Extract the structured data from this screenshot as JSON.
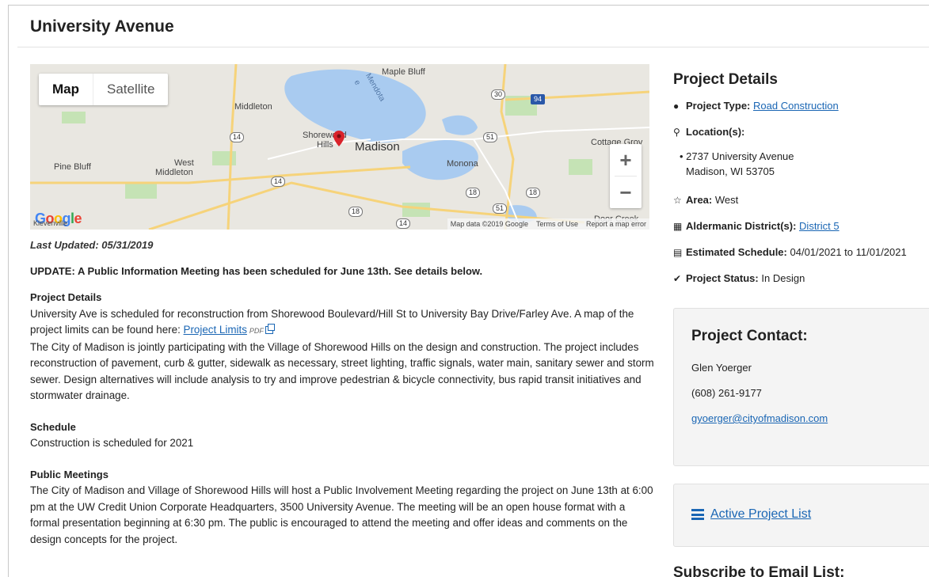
{
  "page": {
    "title": "University Avenue"
  },
  "map": {
    "type_map": "Map",
    "type_satellite": "Satellite",
    "zoom_in": "+",
    "zoom_out": "−",
    "labels": {
      "maple_bluff": "Maple Bluff",
      "middleton": "Middleton",
      "shorewood": "Shorewood",
      "hills": "Hills",
      "madison": "Madison",
      "cottage_grove": "Cottage Grov",
      "pine_bluff": "Pine Bluff",
      "west": "West",
      "west_middleton": "Middleton",
      "monona": "Monona",
      "door_creek": "Door Creek",
      "kleven": "Klevenville",
      "mendota": "Mendota",
      "lake": "e"
    },
    "shields": {
      "r30": "30",
      "r94": "94",
      "r14a": "14",
      "r51a": "51",
      "r14b": "14",
      "r18a": "18",
      "r18b": "18",
      "r18c": "18",
      "r51b": "51",
      "r14c": "14"
    },
    "google": [
      "G",
      "o",
      "o",
      "g",
      "l",
      "e"
    ],
    "attr_data": "Map data ©2019 Google",
    "attr_terms": "Terms of Use",
    "attr_report": "Report a map error"
  },
  "main": {
    "last_updated": "Last Updated: 05/31/2019",
    "update_banner": "UPDATE: A Public Information Meeting has been scheduled for June 13th. See details below.",
    "details_heading": "Project Details",
    "details_p1": "University Ave is scheduled for reconstruction from Shorewood Boulevard/Hill St to University Bay Drive/Farley Ave. A map of the project limits can be found here: ",
    "project_limits_link": "Project Limits",
    "pdf_tag": "PDF",
    "details_p2": "The City of Madison is jointly participating with the Village of Shorewood Hills on the design and construction.  The project includes reconstruction of pavement, curb & gutter, sidewalk as necessary, street lighting, traffic signals, water main, sanitary sewer and storm sewer.  Design alternatives will include analysis to try and improve pedestrian & bicycle connectivity, bus rapid transit initiatives and stormwater drainage.",
    "schedule_heading": "Schedule",
    "schedule_text": "Construction is scheduled for 2021",
    "meetings_heading": "Public Meetings",
    "meetings_text": "The City of Madison and Village of Shorewood Hills will host a Public Involvement Meeting regarding the project on June 13th at 6:00 pm at the UW Credit Union Corporate Headquarters, 3500 University Avenue. The meeting will be an open house format with a formal presentation beginning at 6:30 pm. The public is encouraged to attend the meeting and offer ideas and comments on the design concepts for the project."
  },
  "sidebar": {
    "heading": "Project Details",
    "type_key": "Project Type:",
    "type_value": "Road Construction",
    "location_key": "Location(s):",
    "location_line1": "2737 University Avenue",
    "location_line2": "Madison, WI 53705",
    "area_key": "Area:",
    "area_value": "West",
    "district_key": "Aldermanic District(s):",
    "district_value": "District 5",
    "schedule_key": "Estimated Schedule:",
    "schedule_value": "04/01/2021 to 11/01/2021",
    "status_key": "Project Status:",
    "status_value": "In Design",
    "contact_heading": "Project Contact:",
    "contact_name": "Glen Yoerger",
    "contact_phone": "(608) 261-9177",
    "contact_email": "gyoerger@cityofmadison.com",
    "active_list": "Active Project List",
    "subscribe": "Subscribe to Email List:"
  },
  "icons": {
    "info": "info-circle-icon",
    "map_marker": "map-marker-icon",
    "star": "star-icon",
    "grid": "grid-icon",
    "calendar": "calendar-icon",
    "check": "check-circle-icon",
    "list": "list-icon",
    "external": "external-link-icon",
    "pin": "location-pin-icon"
  },
  "colors": {
    "link": "#1a66b4",
    "water": "#a9cbf0",
    "park": "#c5e3b5",
    "pin": "#d9232a"
  }
}
